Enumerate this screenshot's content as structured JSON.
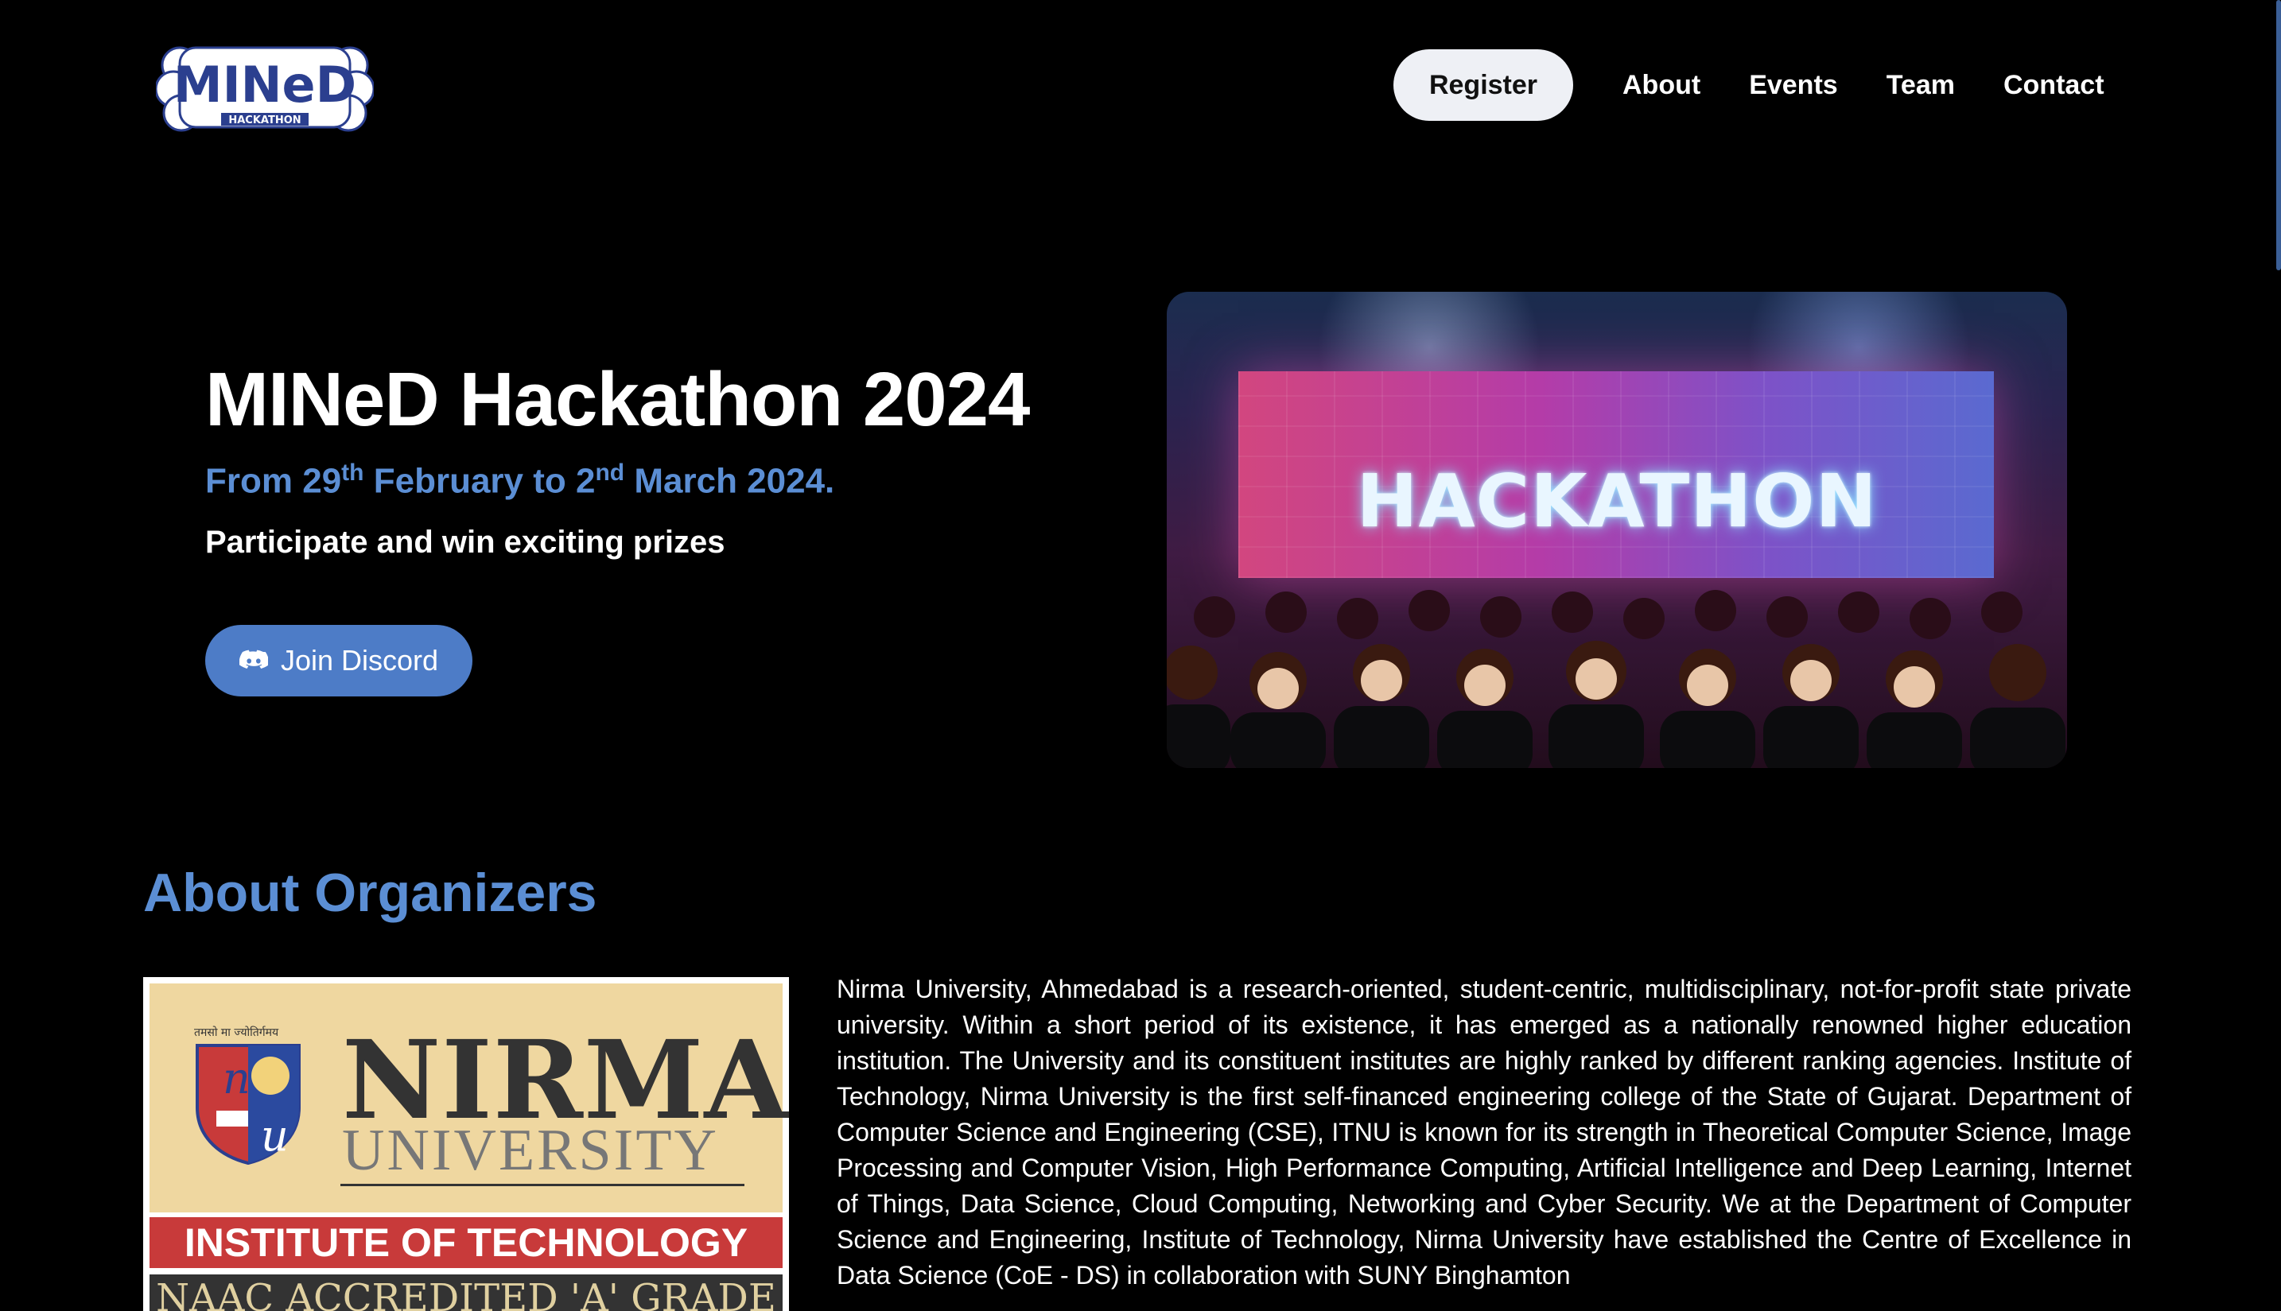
{
  "nav": {
    "logo_text": "MINeD",
    "logo_sub": "HACKATHON",
    "register": "Register",
    "links": [
      "About",
      "Events",
      "Team",
      "Contact"
    ]
  },
  "hero": {
    "title": "MINeD Hackathon 2024",
    "date_from": "From 29",
    "date_from_sup": "th",
    "date_mid": " February to 2",
    "date_to_sup": "nd",
    "date_end": " March 2024.",
    "subtitle": "Participate and win exciting prizes",
    "discord_button": "Join Discord",
    "image_word": "HACKATHON"
  },
  "about": {
    "title": "About Organizers",
    "logo": {
      "motto": "तमसो मा ज्योतिर्गमय",
      "name": "NIRMA",
      "university": "UNIVERSITY",
      "institute": "INSTITUTE OF TECHNOLOGY",
      "naac": "NAAC ACCREDITED 'A' GRADE"
    },
    "text": "Nirma University, Ahmedabad is a research-oriented, student-centric, multidisciplinary, not-for-profit state private university. Within a short period of its existence, it has emerged as a nationally renowned higher education institution. The University and its constituent institutes are highly ranked by different ranking agencies. Institute of Technology, Nirma University is the first self-financed engineering college of the State of Gujarat. Department of Computer Science and Engineering (CSE), ITNU is known for its strength in Theoretical Computer Science, Image Processing and Computer Vision, High Performance Computing, Artificial Intelligence and Deep Learning, Internet of Things, Data Science, Cloud Computing, Networking and Cyber Security. We at the Department of Computer Science and Engineering, Institute of Technology, Nirma University have established the Centre of Excellence in Data Science (CoE - DS) in collaboration with SUNY Binghamton"
  },
  "colors": {
    "accent": "#5b8ed4",
    "discord": "#4d7cc7",
    "background": "#000000"
  }
}
